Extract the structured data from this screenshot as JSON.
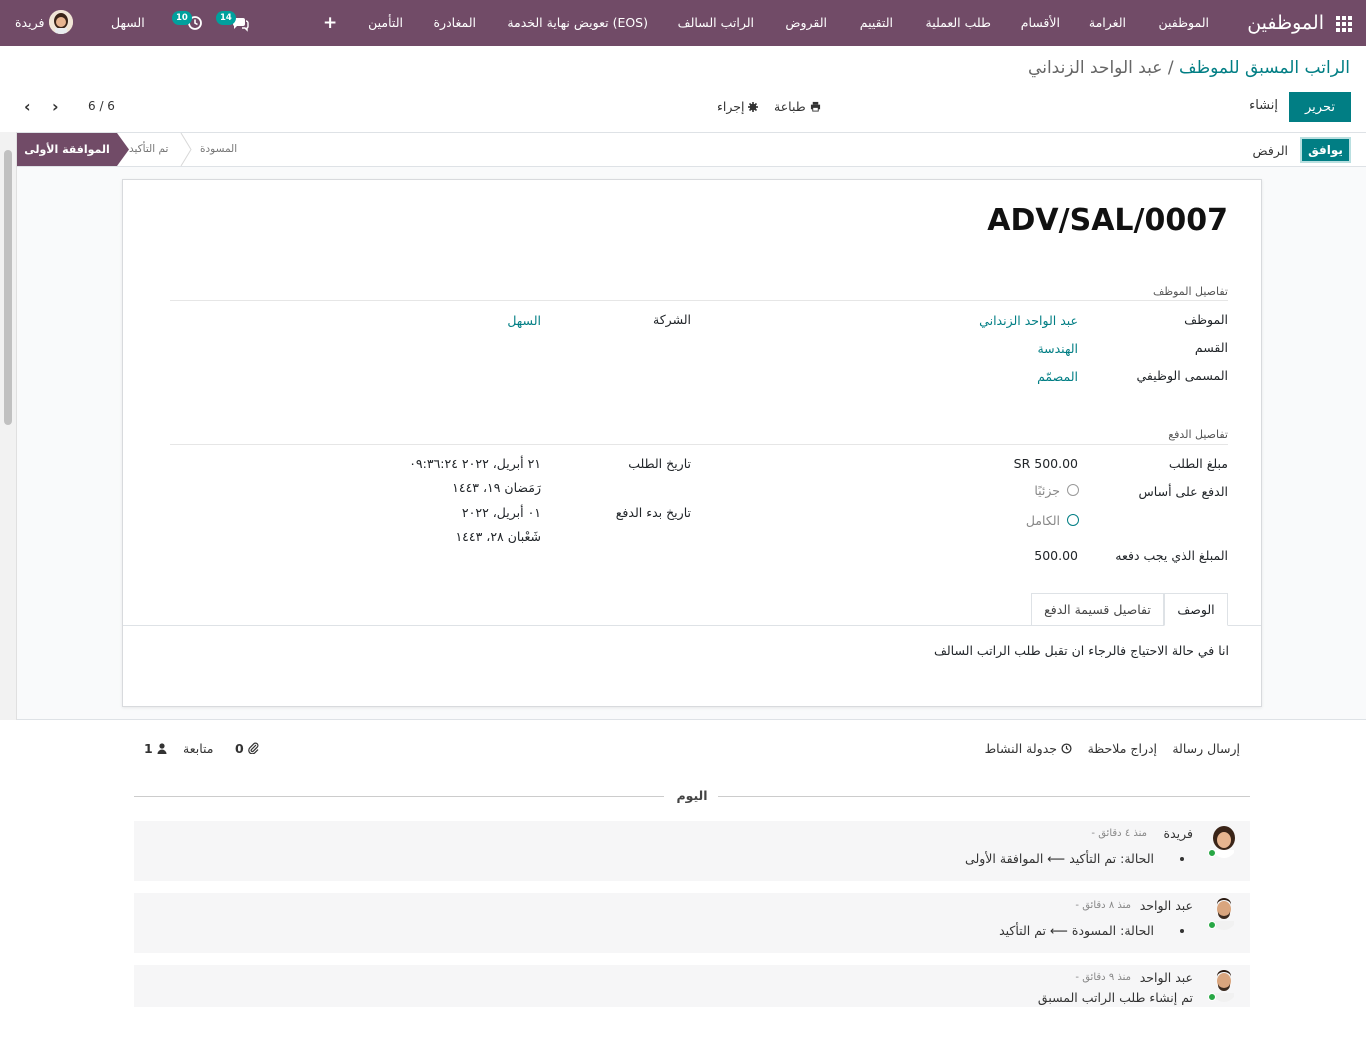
{
  "navbar": {
    "brand": "الموظفين",
    "menu": [
      "الموظفين",
      "الغرامة",
      "الأقسام",
      "طلب العملية",
      "التقييم",
      "القروض",
      "الراتب السالف",
      "تعويض نهاية الخدمة (EOS)",
      "المغادرة",
      "التأمين"
    ],
    "plus": "+",
    "messages_count": "14",
    "activities_count": "10",
    "company": "السهل",
    "user": "فريدة"
  },
  "breadcrumb": {
    "parent": "الراتب المسبق للموظف",
    "separator": "/",
    "current": "عبد الواحد الزنداني"
  },
  "toolbar": {
    "edit_label": "تحرير",
    "create_label": "إنشاء",
    "print_label": "طباعة",
    "action_label": "إجراء",
    "pager": "6 / 6"
  },
  "statusbar": {
    "approve_label": "يوافق",
    "reject_label": "الرفض",
    "stages": [
      "الموافقة الأولى",
      "تم التأكيد",
      "المسودة"
    ],
    "active_stage": "الموافقة الأولى"
  },
  "form": {
    "reference": "ADV/SAL/0007",
    "employee_section": "تفاصيل الموظف",
    "employee_label": "الموظف",
    "employee_value": "عبد الواحد الزنداني",
    "department_label": "القسم",
    "department_value": "الهندسة",
    "job_label": "المسمى الوظيفي",
    "job_value": "المصمّم",
    "company_label": "الشركة",
    "company_value": "السهل",
    "payment_section": "تفاصيل الدفع",
    "amount_label": "مبلغ الطلب",
    "amount_value": "SR 500.00",
    "basis_label": "الدفع على أساس",
    "basis_options": [
      "جزئيًا",
      "الكامل"
    ],
    "basis_selected": "الكامل",
    "due_label": "المبلغ الذي يجب دفعه",
    "due_value": "500.00",
    "request_date_label": "تاريخ الطلب",
    "request_date_value": "٢١ أبريل، ٢٠٢٢ ٠٩:٣٦:٢٤",
    "request_date_hijri": "رَمَضان ١٩، ١٤٤٣",
    "start_date_label": "تاريخ بدء الدفع",
    "start_date_value": "٠١ أبريل، ٢٠٢٢",
    "start_date_hijri": "شَعْبان ٢٨، ١٤٤٣",
    "tabs": [
      "الوصف",
      "تفاصيل قسيمة الدفع"
    ],
    "active_tab": "الوصف",
    "description": "انا في حالة الاحتياج فالرجاء ان تقبل طلب الراتب السالف"
  },
  "chatter": {
    "send_message": "إرسال رسالة",
    "log_note": "إدراج ملاحظة",
    "schedule_activity": "جدولة النشاط",
    "attachments_count": "0",
    "follow_label": "متابعة",
    "followers_count": "1",
    "day_label": "اليوم",
    "messages": [
      {
        "author": "فريدة",
        "when": "- منذ ٤ دقائق",
        "field": "الحالة:",
        "from": "تم التأكيد",
        "to": "الموافقة الأولى"
      },
      {
        "author": "عبد الواحد",
        "when": "- منذ ٨ دقائق",
        "field": "الحالة:",
        "from": "المسودة",
        "to": "تم التأكيد"
      },
      {
        "author": "عبد الواحد",
        "when": "- منذ ٩ دقائق",
        "body": "تم إنشاء طلب الراتب المسبق"
      }
    ]
  },
  "colors": {
    "navbar": "#714b67",
    "primary": "#017e84",
    "badge": "#00a09d"
  }
}
